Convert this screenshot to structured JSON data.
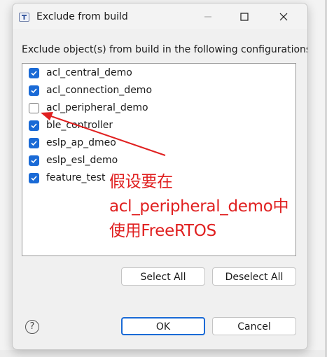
{
  "window": {
    "title": "Exclude from build",
    "minimize_icon": "minimize-icon",
    "maximize_icon": "maximize-icon",
    "close_icon": "close-icon"
  },
  "instruction": "Exclude object(s) from build in the following configurations",
  "configurations": [
    {
      "label": "acl_central_demo",
      "checked": true
    },
    {
      "label": "acl_connection_demo",
      "checked": true
    },
    {
      "label": "acl_peripheral_demo",
      "checked": false
    },
    {
      "label": "ble_controller",
      "checked": true
    },
    {
      "label": "eslp_ap_dmeo",
      "checked": true
    },
    {
      "label": "eslp_esl_demo",
      "checked": true
    },
    {
      "label": "feature_test",
      "checked": true
    }
  ],
  "buttons": {
    "select_all": "Select All",
    "deselect_all": "Deselect All",
    "ok": "OK",
    "cancel": "Cancel"
  },
  "help_icon": "help-icon",
  "annotation": {
    "lines": [
      "假设要在",
      "acl_peripheral_demo中",
      "使用FreeRTOS"
    ],
    "color": "#e02020"
  },
  "colors": {
    "accent": "#1a6ad6"
  }
}
